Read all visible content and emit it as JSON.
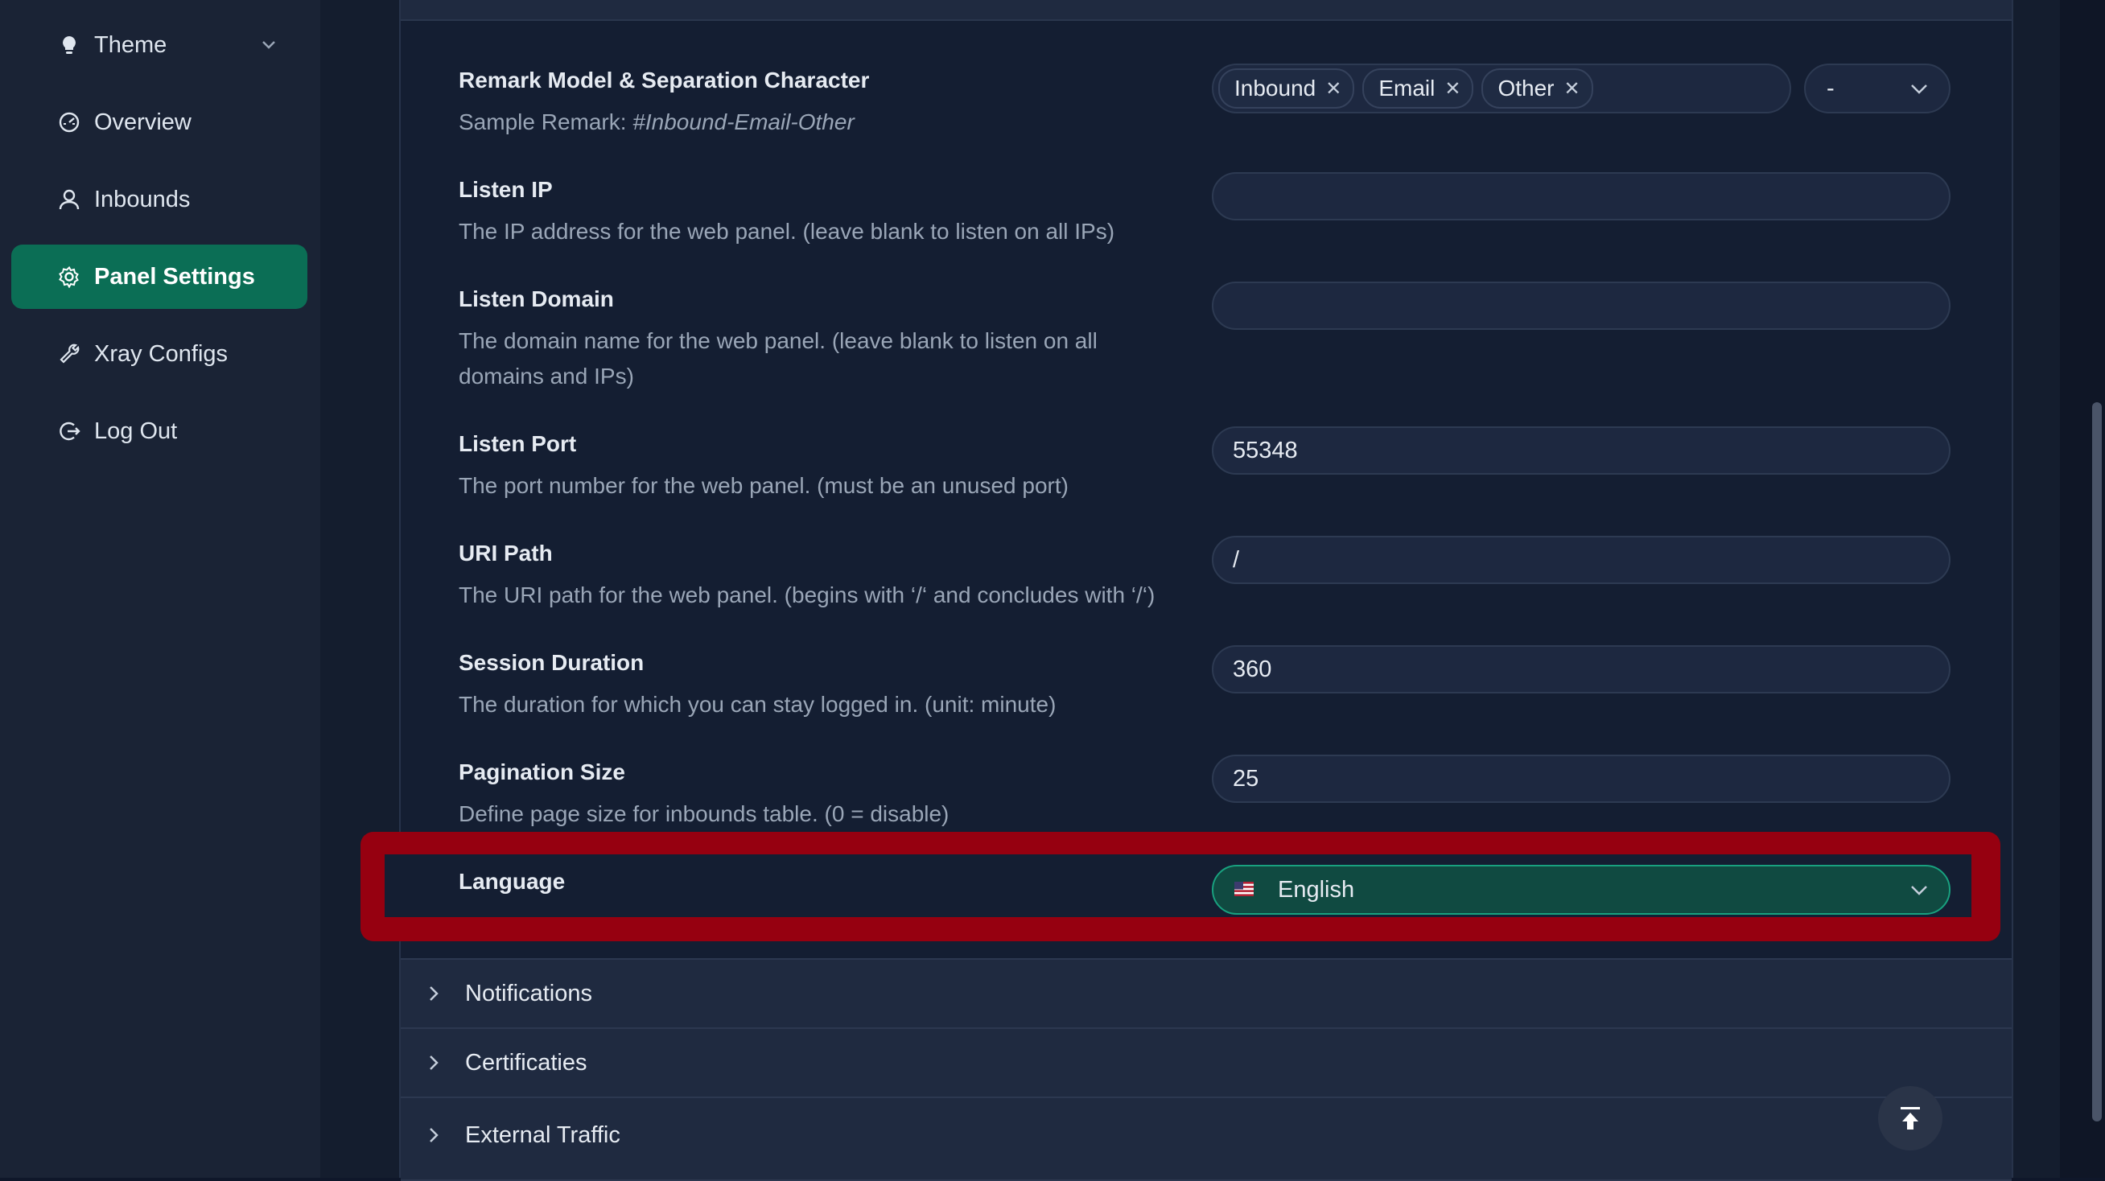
{
  "sidebar": {
    "items": [
      {
        "label": "Theme",
        "icon": "lightbulb-icon"
      },
      {
        "label": "Overview",
        "icon": "dashboard-icon"
      },
      {
        "label": "Inbounds",
        "icon": "user-icon"
      },
      {
        "label": "Panel Settings",
        "icon": "gear-icon"
      },
      {
        "label": "Xray Configs",
        "icon": "wrench-icon"
      },
      {
        "label": "Log Out",
        "icon": "logout-icon"
      }
    ]
  },
  "settings": {
    "remark": {
      "title": "Remark Model & Separation Character",
      "desc_prefix": "Sample Remark: ",
      "desc_sample": "#Inbound-Email-Other",
      "tags": [
        "Inbound",
        "Email",
        "Other"
      ],
      "separator": "-"
    },
    "listen_ip": {
      "title": "Listen IP",
      "desc": "The IP address for the web panel. (leave blank to listen on all IPs)",
      "value": ""
    },
    "listen_domain": {
      "title": "Listen Domain",
      "desc": "The domain name for the web panel. (leave blank to listen on all domains and IPs)",
      "value": ""
    },
    "listen_port": {
      "title": "Listen Port",
      "desc": "The port number for the web panel. (must be an unused port)",
      "value": "55348"
    },
    "uri_path": {
      "title": "URI Path",
      "desc": "The URI path for the web panel. (begins with ‘/‘ and concludes with ‘/‘)",
      "value": "/"
    },
    "session_duration": {
      "title": "Session Duration",
      "desc": "The duration for which you can stay logged in. (unit: minute)",
      "value": "360"
    },
    "pagination_size": {
      "title": "Pagination Size",
      "desc": "Define page size for inbounds table. (0 = disable)",
      "value": "25"
    },
    "language": {
      "title": "Language",
      "value": "English",
      "flag": "us-flag-icon"
    }
  },
  "sections": [
    {
      "label": "Notifications"
    },
    {
      "label": "Certificaties"
    },
    {
      "label": "External Traffic"
    }
  ],
  "colors": {
    "accent": "#0b6e55",
    "highlight": "#960010",
    "background": "#141e32"
  }
}
